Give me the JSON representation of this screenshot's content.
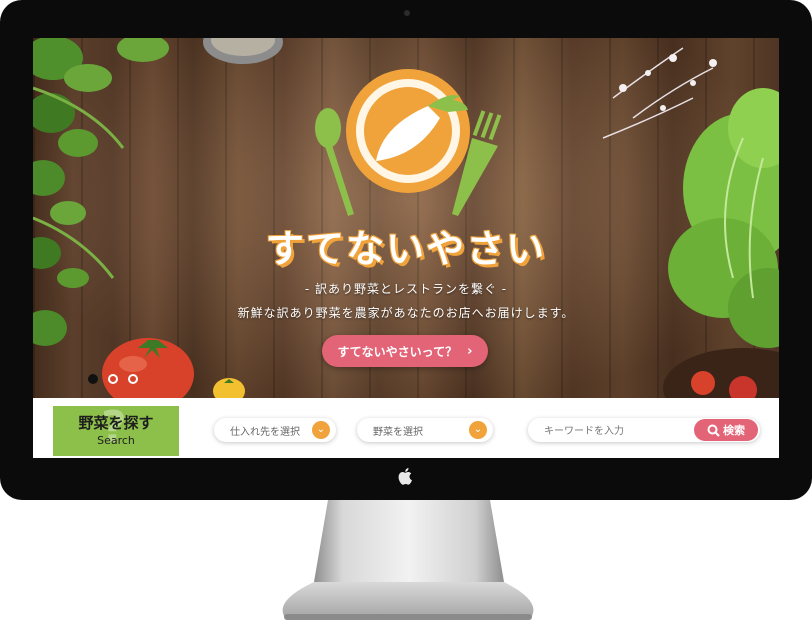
{
  "brand": {
    "title": "すてないやさい",
    "tagline": "- 訳あり野菜とレストランを繋ぐ -",
    "subcopy": "新鮮な訳あり野菜を農家があなたのお店へお届けします。"
  },
  "hero": {
    "cta_label": "すてないやさいって？",
    "cta_chevron": "›",
    "slides": [
      {
        "active": true
      },
      {
        "active": false
      },
      {
        "active": false
      }
    ]
  },
  "search": {
    "heading_jp": "野菜を探す",
    "heading_en": "Search",
    "heading_glyph": "?",
    "supplier_select": "仕入れ先を選択",
    "vegetable_select": "野菜を選択",
    "select_arrow": "⌄",
    "keyword_placeholder": "キーワードを入力",
    "search_button": "検索"
  },
  "colors": {
    "accent_pink": "#e36477",
    "accent_orange": "#f0a33a",
    "accent_green": "#8dc04a",
    "bezel": "#0b0b0b"
  },
  "icons": [
    "carrot-plate-logo",
    "spoon-icon",
    "fork-icon",
    "search-icon",
    "chevron-down-icon",
    "apple-logo-icon"
  ]
}
